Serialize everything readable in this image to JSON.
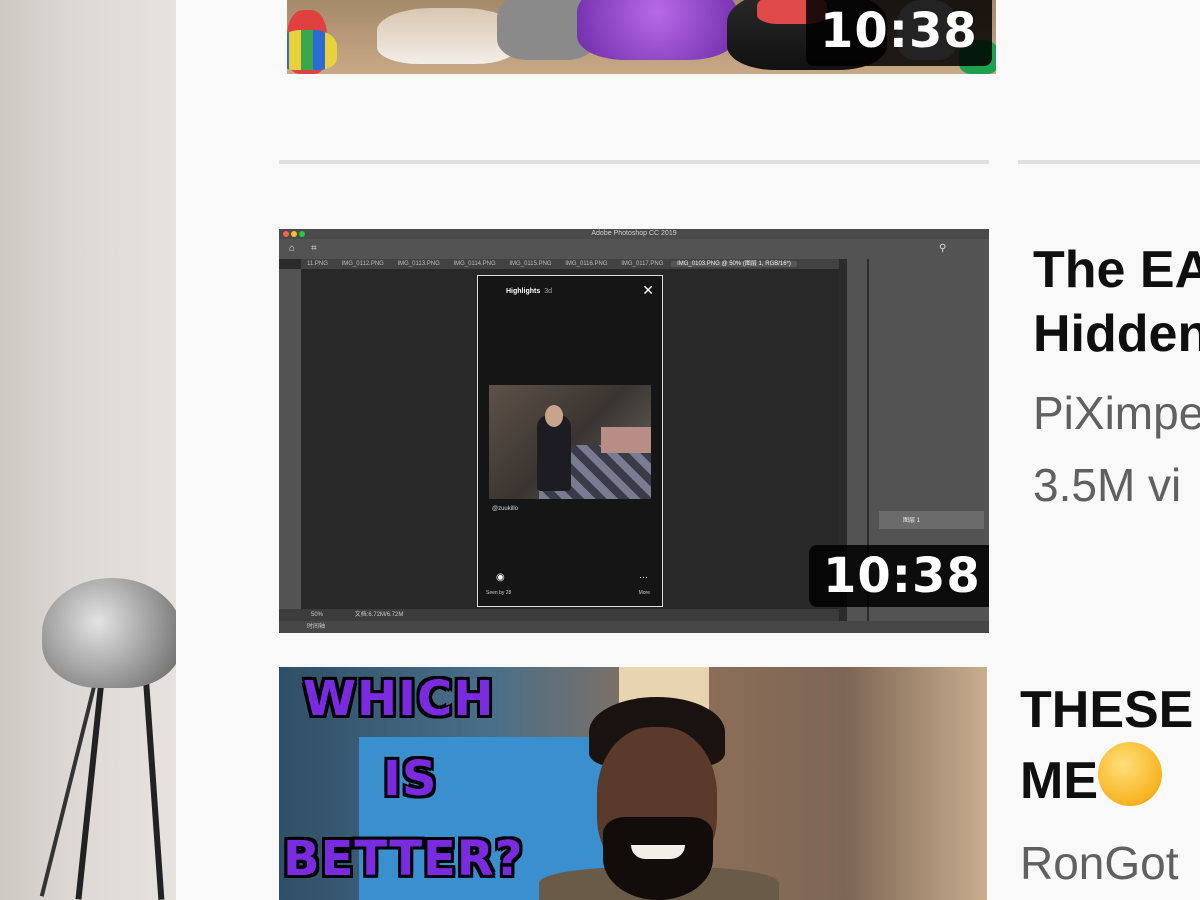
{
  "videos": [
    {
      "duration": "10:38",
      "thumbnail": "shoes-thumbnail"
    },
    {
      "duration": "10:38",
      "title_lines": [
        "The EA",
        "Hidden"
      ],
      "channel": "PiXimpe",
      "views": "3.5M vi",
      "thumbnail_screen": {
        "app_title": "Adobe Photoshop CC 2019",
        "tabs": [
          "11.PNG",
          "IMG_0112.PNG",
          "IMG_0113.PNG",
          "IMG_0114.PNG",
          "IMG_0115.PNG",
          "IMG_0116.PNG",
          "IMG_0117.PNG",
          "IMG_0103.PNG @ 50% (图层 1, RGB/16*)"
        ],
        "zoom": "50%",
        "doc_info": "文档:6.72M/6.72M",
        "status": "时间轴",
        "layer_name": "图层 1",
        "story": {
          "header": "Highlights",
          "time": "3d",
          "username": "@zuukillo",
          "seen": "Seen by 28",
          "more": "More"
        }
      }
    },
    {
      "title_lines": [
        "THESE",
        "ME"
      ],
      "channel": "RonGot",
      "thumbnail_text": [
        "WHICH",
        "IS",
        "BETTER?"
      ]
    }
  ],
  "colors": {
    "page_bg": "#f9f9f9",
    "title_text": "#0f0f0f",
    "meta_text": "#606060",
    "thumb_text_purple": "#7a2be0"
  },
  "icons": {
    "emoji": "astonished-face-icon"
  }
}
